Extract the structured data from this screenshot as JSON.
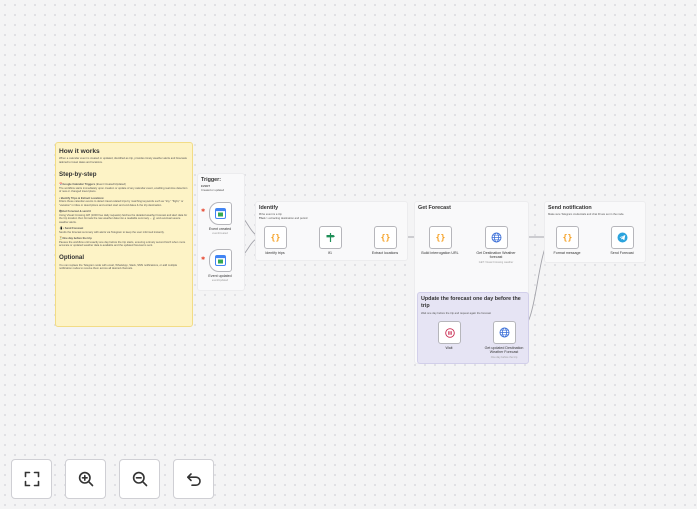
{
  "notes": {
    "how_it_works": {
      "title": "How it works",
      "intro": "When a calendar event is created or updated, identified as trip, provides timely weather alerts and forecasts tailored to travel dates and locations.",
      "step_title": "Step-by-step",
      "s1_title": "📅Google Calendar Triggers",
      "s1_title_suffix": " (Event Created/Updated)",
      "s1_text": "The workflow starts immediately upon creation or update of any calendar event, enabling real-time detection of new or changed travel plans.",
      "s2_title": "• Identify Trips & Extract Locations:",
      "s2_text": "Filters these calendar events to detect travel-related trips by matching keywords such as \"trip,\" \"flight,\" or \"vacation\" in titles or descriptions and extract start and end dates & the trip destination.",
      "s3_title": "🌤Get Forecast & send it",
      "s3_text": "Using Visual Crossing API (1000 free daily requests) fetches the detailed weather forecast and alert data for the trip location then formats the raw weather data into a readable summary – 🌡 and eventual severe weather alerts.",
      "s4_title": "📲 • Send Forecast",
      "s4_text": "Sends the forecast summary with alerts via Telegram to keep the user informed instantly.",
      "s5_title": "⏳One day before the trip",
      "s5_text": "Pauses the workflow until exactly one day before the trip starts, ensuring a timely second fetch when more accurate or updated weather data is available and the updated forecast is sent.",
      "optional_title": "Optional",
      "optional_text": "You can replace the Telegram node with email, WhatsApp, Slack, SMS notifications, or add multiple notification nodes to receive them across all desired channels."
    },
    "trigger": {
      "title": "Trigger:",
      "sub1": "EVENT",
      "sub2": "Created or updated"
    },
    "identify": {
      "title": "Identify",
      "line1_bold": "If",
      "line1": " the event is a trip",
      "line2_bold": "Then",
      "line2": " > extracting destination and period"
    },
    "forecast": {
      "title": "Get Forecast"
    },
    "send": {
      "title": "Send notification",
      "text": "Make sure Telegram credentials and chat ID are set in the node."
    },
    "update": {
      "title": "Update the forecast one day before the trip",
      "text": "Wait one day before the trip and request again the forecast"
    }
  },
  "nodes": {
    "event_created": {
      "label": "Event created",
      "sub": "eventCreated"
    },
    "event_updated": {
      "label": "Event updated",
      "sub": "eventUpdated"
    },
    "identify_trips": {
      "label": "Identify trips"
    },
    "if": {
      "label": "If1"
    },
    "extract_locations": {
      "label": "Extract locations"
    },
    "build_url": {
      "label": "Build interrogation URL"
    },
    "get_weather": {
      "label": "Get Destination Weather forecast",
      "sub": "GET: Visual Crossing weather"
    },
    "format_message": {
      "label": "Format message"
    },
    "send_forecast": {
      "label": "Send Forecast"
    },
    "wait": {
      "label": "Wait"
    },
    "get_updated": {
      "label": "Get updated Destination Weather Forecast",
      "sub": "One day before the trip"
    }
  },
  "colors": {
    "accent_orange": "#f59c1a",
    "note_yellow": "#fdf3c6",
    "note_purple": "#e6e4f4",
    "trigger_star": "#e8533e",
    "telegram_blue": "#2aa3dd"
  },
  "controls": {
    "fit": "fit-view-icon",
    "zoom_in": "zoom-in-icon",
    "zoom_out": "zoom-out-icon",
    "undo": "undo-icon"
  }
}
